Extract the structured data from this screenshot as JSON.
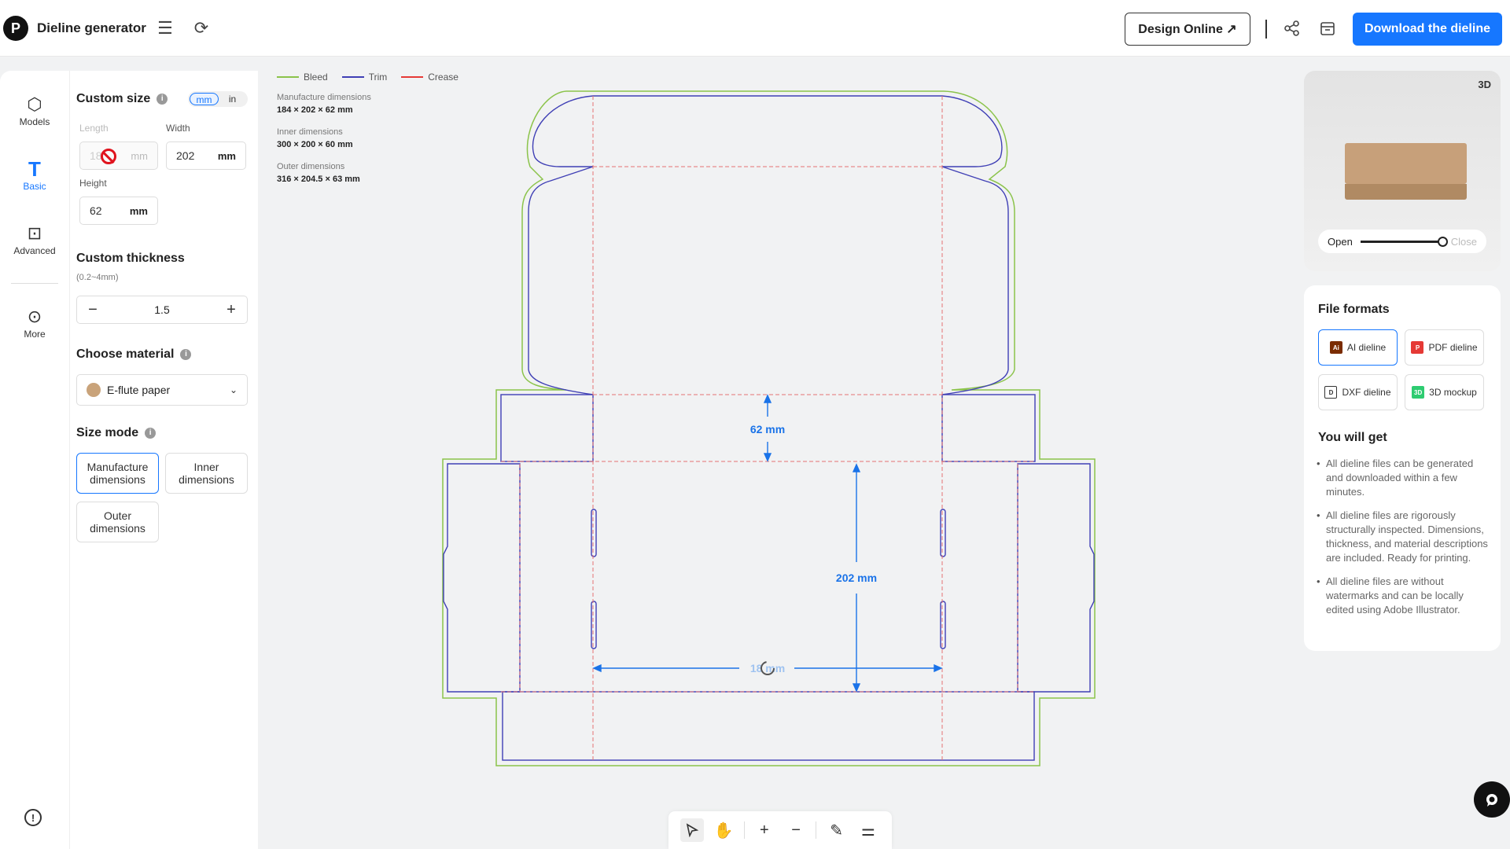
{
  "app": {
    "title": "Dieline generator"
  },
  "header": {
    "design_online": "Design Online ↗",
    "download": "Download the dieline"
  },
  "rail": {
    "items": [
      {
        "label": "Models",
        "icon": "cube-icon"
      },
      {
        "label": "Basic",
        "icon": "t-icon"
      },
      {
        "label": "Advanced",
        "icon": "advanced-icon"
      },
      {
        "label": "More",
        "icon": "more-icon"
      }
    ]
  },
  "settings": {
    "custom_size": "Custom size",
    "unit_mm": "mm",
    "unit_in": "in",
    "length_label": "Length",
    "width_label": "Width",
    "height_label": "Height",
    "length_value": "18",
    "length_unit": "mm",
    "width_value": "202",
    "width_unit": "mm",
    "height_value": "62",
    "height_unit": "mm",
    "thickness_title": "Custom thickness",
    "thickness_range": "(0.2~4mm)",
    "thickness_value": "1.5",
    "material_title": "Choose material",
    "material_value": "E-flute paper",
    "size_mode_title": "Size mode",
    "mode_manufacture_1": "Manufacture",
    "mode_manufacture_2": "dimensions",
    "mode_inner_1": "Inner",
    "mode_inner_2": "dimensions",
    "mode_outer_1": "Outer",
    "mode_outer_2": "dimensions"
  },
  "legend": {
    "bleed": "Bleed",
    "trim": "Trim",
    "crease": "Crease",
    "bleed_color": "#8bc34a",
    "trim_color": "#3f3fb5",
    "crease_color": "#e53935"
  },
  "dims": {
    "manufacture_label": "Manufacture dimensions",
    "manufacture_value": "184 × 202 × 62 mm",
    "inner_label": "Inner dimensions",
    "inner_value": "300 × 200 × 60 mm",
    "outer_label": "Outer dimensions",
    "outer_value": "316 × 204.5 × 63 mm"
  },
  "canvas": {
    "height_dim": "62 mm",
    "width_dim": "202 mm",
    "length_dim": "18 mm"
  },
  "preview": {
    "badge": "3D",
    "open": "Open",
    "close": "Close",
    "slider_value": 1.0
  },
  "formats": {
    "title": "File formats",
    "items": [
      {
        "label": "AI dieline",
        "icon_color": "#7a2c00"
      },
      {
        "label": "PDF dieline",
        "icon_color": "#e53935"
      },
      {
        "label": "DXF dieline",
        "icon_color": "#333333"
      },
      {
        "label": "3D mockup",
        "icon_color": "#2ecc71"
      }
    ],
    "you_get_title": "You will get",
    "benefits": [
      "All dieline files can be generated and downloaded within a few minutes.",
      "All dieline files are rigorously structurally inspected. Dimensions, thickness, and material descriptions are included. Ready for printing.",
      "All dieline files are without watermarks and can be locally edited using Adobe Illustrator."
    ]
  },
  "colors": {
    "accent": "#1677ff"
  }
}
